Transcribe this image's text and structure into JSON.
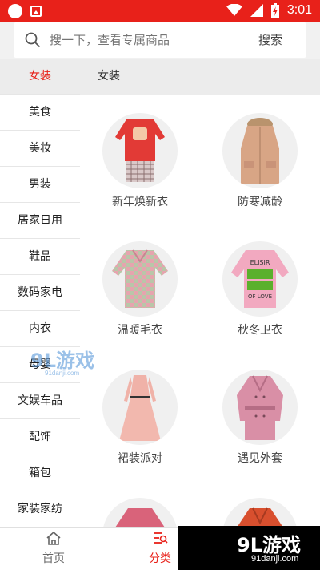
{
  "status_bar": {
    "time": "3:01",
    "icons": [
      "circle-icon",
      "gallery-icon",
      "wifi-icon",
      "signal-icon",
      "battery-charging-icon"
    ]
  },
  "search": {
    "placeholder": "搜一下，查看专属商品",
    "button_label": "搜索"
  },
  "sidebar": {
    "items": [
      {
        "label": "女装",
        "active": true
      },
      {
        "label": "美食"
      },
      {
        "label": "美妆"
      },
      {
        "label": "男装"
      },
      {
        "label": "居家日用"
      },
      {
        "label": "鞋品"
      },
      {
        "label": "数码家电"
      },
      {
        "label": "内衣"
      },
      {
        "label": "母婴"
      },
      {
        "label": "文娱车品"
      },
      {
        "label": "配饰"
      },
      {
        "label": "箱包"
      },
      {
        "label": "家装家纺"
      }
    ]
  },
  "main": {
    "header": "女装",
    "tiles": [
      {
        "label": "新年焕新衣",
        "image": "red-sweater-plaid-skirt"
      },
      {
        "label": "防寒减龄",
        "image": "tan-parka"
      },
      {
        "label": "温暖毛衣",
        "image": "pink-check-sweater"
      },
      {
        "label": "秋冬卫衣",
        "image": "pink-sweatshirt",
        "image_text": [
          "ELISIR",
          "OF LOVE"
        ]
      },
      {
        "label": "裙装派对",
        "image": "pink-dress"
      },
      {
        "label": "遇见外套",
        "image": "pink-trench-coat"
      },
      {
        "label": "",
        "image": "pink-top"
      },
      {
        "label": "",
        "image": "orange-coat"
      }
    ]
  },
  "bottom_nav": {
    "items": [
      {
        "label": "首页",
        "icon": "home-icon",
        "active": false
      },
      {
        "label": "分类",
        "icon": "category-icon",
        "active": true
      }
    ]
  },
  "watermark": {
    "logo_text": "9L游戏",
    "url_text": "91danji.com"
  },
  "colors": {
    "accent": "#e8211a",
    "sidebar_active_bg": "#ececec",
    "tile_bg": "#f0f0f0"
  }
}
